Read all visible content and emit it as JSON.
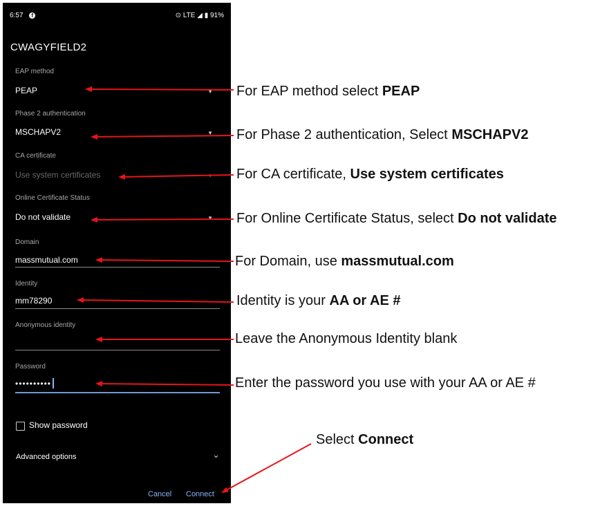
{
  "status_bar": {
    "time": "6:57",
    "network": "LTE",
    "battery": "91%"
  },
  "network_name": "CWAGYFIELD2",
  "fields": {
    "eap_method": {
      "label": "EAP method",
      "value": "PEAP"
    },
    "phase2": {
      "label": "Phase 2 authentication",
      "value": "MSCHAPV2"
    },
    "ca_cert": {
      "label": "CA certificate",
      "value": "Use system certificates"
    },
    "ocsp": {
      "label": "Online Certificate Status",
      "value": "Do not validate"
    },
    "domain": {
      "label": "Domain",
      "value": "massmutual.com"
    },
    "identity": {
      "label": "Identity",
      "value": "mm78290"
    },
    "anon_identity": {
      "label": "Anonymous identity",
      "value": ""
    },
    "password": {
      "label": "Password",
      "value": "••••••••••"
    }
  },
  "show_password_label": "Show password",
  "advanced_label": "Advanced options",
  "buttons": {
    "cancel": "Cancel",
    "connect": "Connect"
  },
  "annotations": {
    "eap": {
      "pre": "For EAP method select ",
      "bold": "PEAP",
      "post": ""
    },
    "phase2": {
      "pre": "For Phase 2 authentication, Select ",
      "bold": "MSCHAPV2",
      "post": ""
    },
    "ca": {
      "pre": "For CA certificate, ",
      "bold": "Use system certificates",
      "post": ""
    },
    "ocsp": {
      "pre": "For Online Certificate Status, select ",
      "bold": "Do not validate",
      "post": ""
    },
    "domain": {
      "pre": "For Domain, use ",
      "bold": "massmutual.com",
      "post": ""
    },
    "identity": {
      "pre": "Identity is your ",
      "bold": "AA or AE #",
      "post": ""
    },
    "anon": {
      "pre": "Leave the Anonymous Identity blank",
      "bold": "",
      "post": ""
    },
    "password": {
      "pre": "Enter the password you use with your AA or AE #",
      "bold": "",
      "post": ""
    },
    "connect": {
      "pre": "Select ",
      "bold": "Connect",
      "post": ""
    }
  },
  "colors": {
    "arrow": "#e8141b",
    "accent": "#8ab4f8",
    "phone_bg": "#000000"
  },
  "icons": [
    "facebook-icon",
    "wifi-calling-icon",
    "signal-icon",
    "battery-icon",
    "dropdown-arrow-icon",
    "chevron-down-icon",
    "checkbox-icon"
  ]
}
